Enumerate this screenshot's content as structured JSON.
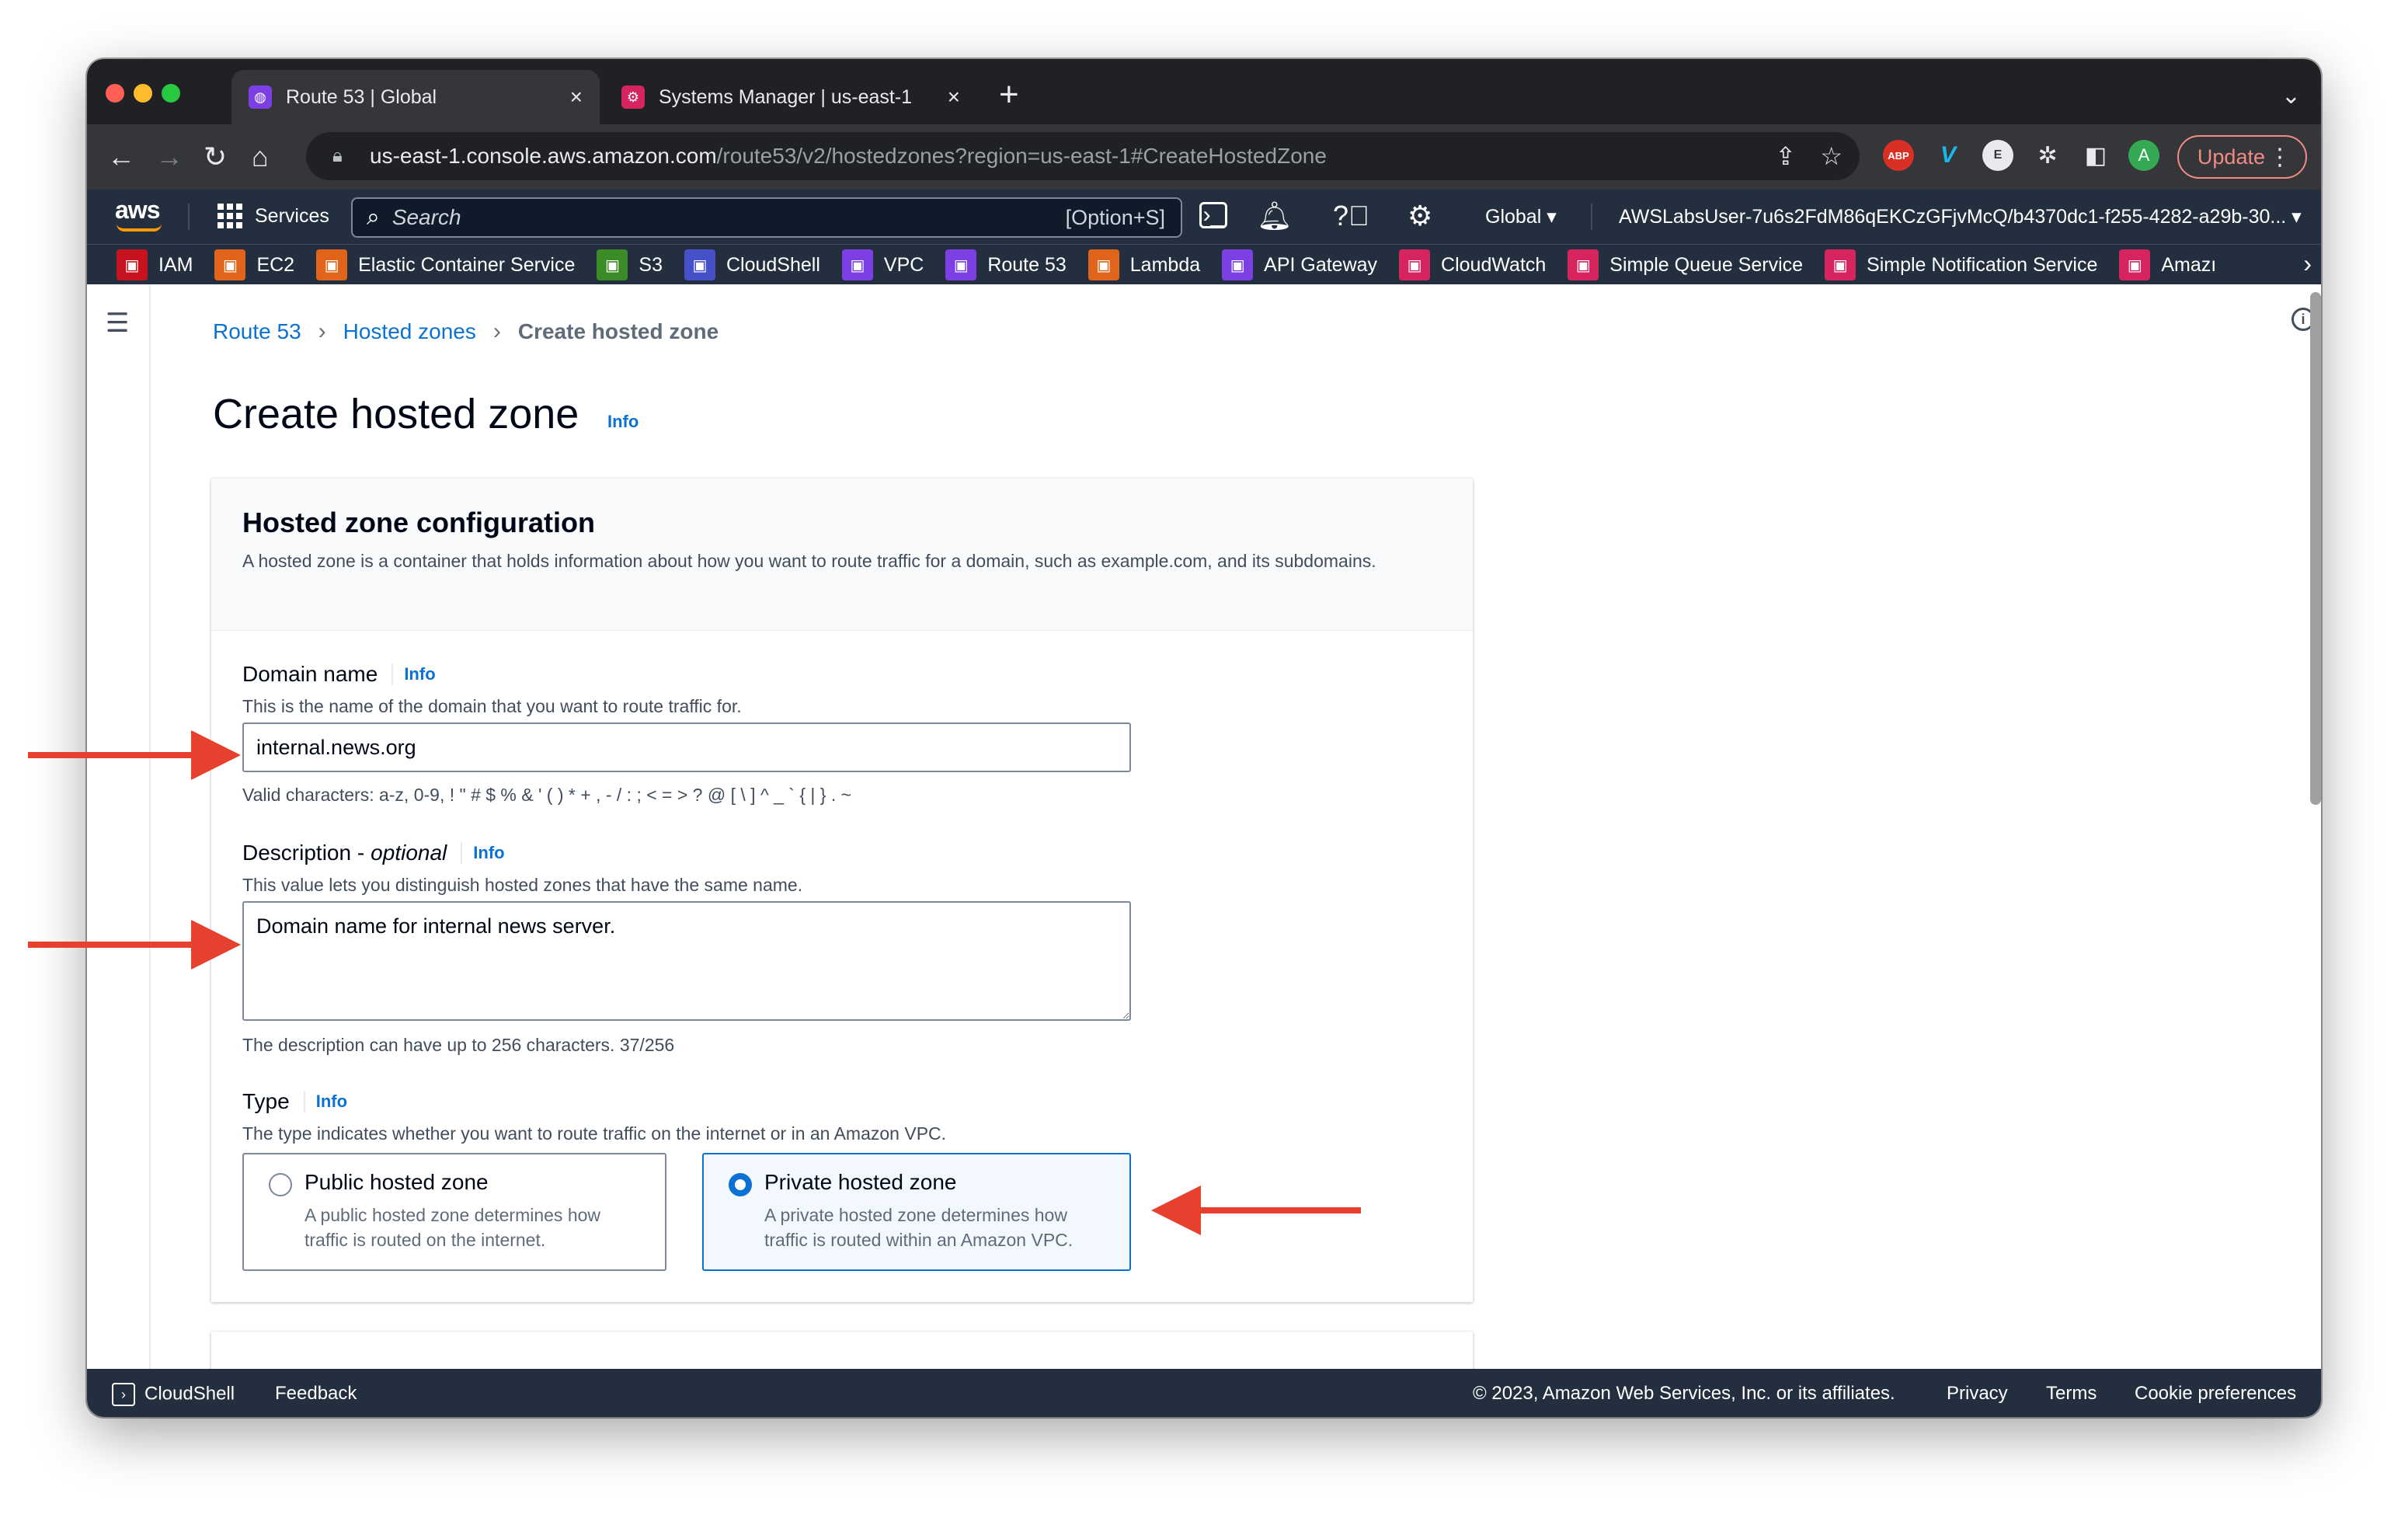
{
  "browser": {
    "tabs": [
      {
        "title": "Route 53 | Global",
        "icon": "route53-icon",
        "active": true
      },
      {
        "title": "Systems Manager | us-east-1",
        "icon": "systems-manager-icon",
        "active": false
      }
    ],
    "url_host": "us-east-1.console.aws.amazon.com",
    "url_path": "/route53/v2/hostedzones?region=us-east-1#CreateHostedZone",
    "extensions": [
      {
        "name": "adblock-plus-icon",
        "label": "ABP"
      },
      {
        "name": "vimeo-icon",
        "label": "V"
      },
      {
        "name": "extension-e-icon",
        "label": "E"
      },
      {
        "name": "puzzle-icon",
        "label": "✲"
      },
      {
        "name": "sidepanel-icon",
        "label": "◧"
      },
      {
        "name": "profile-avatar",
        "label": "A"
      }
    ],
    "update_label": "Update"
  },
  "aws_nav": {
    "logo": "aws",
    "services_label": "Services",
    "search_placeholder": "Search",
    "search_shortcut": "[Option+S]",
    "region": "Global ▾",
    "account": "AWSLabsUser-7u6s2FdM86qEKCzGFjvMcQ/b4370dc1-f255-4282-a29b-30... ▾"
  },
  "favorites": [
    {
      "label": "IAM",
      "icon": "iam-icon",
      "color": "#c7131f"
    },
    {
      "label": "EC2",
      "icon": "ec2-icon",
      "color": "#e0651b"
    },
    {
      "label": "Elastic Container Service",
      "icon": "ecs-icon",
      "color": "#e0651b"
    },
    {
      "label": "S3",
      "icon": "s3-icon",
      "color": "#3b8b27"
    },
    {
      "label": "CloudShell",
      "icon": "cloudshell-icon",
      "color": "#4650c8"
    },
    {
      "label": "VPC",
      "icon": "vpc-icon",
      "color": "#7b3fe4"
    },
    {
      "label": "Route 53",
      "icon": "route53-icon",
      "color": "#7b3fe4"
    },
    {
      "label": "Lambda",
      "icon": "lambda-icon",
      "color": "#e0651b"
    },
    {
      "label": "API Gateway",
      "icon": "api-gateway-icon",
      "color": "#7b3fe4"
    },
    {
      "label": "CloudWatch",
      "icon": "cloudwatch-icon",
      "color": "#d6245f"
    },
    {
      "label": "Simple Queue Service",
      "icon": "sqs-icon",
      "color": "#d6245f"
    },
    {
      "label": "Simple Notification Service",
      "icon": "sns-icon",
      "color": "#d6245f"
    },
    {
      "label": "Amazı",
      "icon": "amazon-service-icon",
      "color": "#d6245f"
    }
  ],
  "breadcrumb": {
    "items": [
      "Route 53",
      "Hosted zones"
    ],
    "current": "Create hosted zone"
  },
  "page": {
    "title": "Create hosted zone",
    "info": "Info"
  },
  "config_panel": {
    "title": "Hosted zone configuration",
    "description": "A hosted zone is a container that holds information about how you want to route traffic for a domain, such as example.com, and its subdomains.",
    "domain": {
      "label": "Domain name",
      "info": "Info",
      "description": "This is the name of the domain that you want to route traffic for.",
      "value": "internal.news.org",
      "constraint": "Valid characters: a-z, 0-9, ! \" # $ % & ' ( ) * + , - / : ; < = > ? @ [ \\ ] ^ _ ` { | } . ~"
    },
    "description_field": {
      "label": "Description - ",
      "label_optional": "optional",
      "info": "Info",
      "description": "This value lets you distinguish hosted zones that have the same name.",
      "value": "Domain name for internal news server.",
      "constraint": "The description can have up to 256 characters. 37/256"
    },
    "type": {
      "label": "Type",
      "info": "Info",
      "description": "The type indicates whether you want to route traffic on the internet or in an Amazon VPC.",
      "options": [
        {
          "label": "Public hosted zone",
          "description": "A public hosted zone determines how traffic is routed on the internet.",
          "selected": false
        },
        {
          "label": "Private hosted zone",
          "description": "A private hosted zone determines how traffic is routed within an Amazon VPC.",
          "selected": true
        }
      ]
    }
  },
  "footer": {
    "cloudshell": "CloudShell",
    "feedback": "Feedback",
    "copyright": "© 2023, Amazon Web Services, Inc. or its affiliates.",
    "privacy": "Privacy",
    "terms": "Terms",
    "cookies": "Cookie preferences"
  },
  "colors": {
    "annotation_arrow": "#e8402f",
    "aws_nav_bg": "#232f3e",
    "link": "#0972d3"
  }
}
